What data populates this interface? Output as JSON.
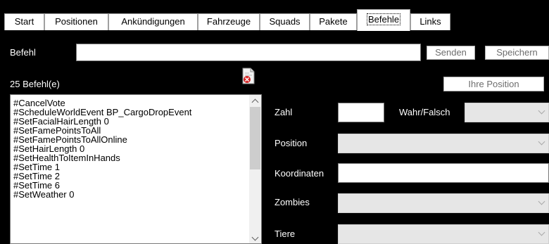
{
  "tabs": [
    {
      "label": "Start",
      "active": false
    },
    {
      "label": "Positionen",
      "active": false
    },
    {
      "label": "Ankündigungen",
      "active": false
    },
    {
      "label": "Fahrzeuge",
      "active": false
    },
    {
      "label": "Squads",
      "active": false
    },
    {
      "label": "Pakete",
      "active": false
    },
    {
      "label": "Befehle",
      "active": true
    },
    {
      "label": "Links",
      "active": false
    }
  ],
  "command_bar": {
    "label": "Befehl",
    "input_value": "",
    "send_label": "Senden",
    "save_label": "Speichern"
  },
  "commands": {
    "count_label": "25  Befehl(e)",
    "items": [
      "#CancelVote",
      "#ScheduleWorldEvent BP_CargoDropEvent",
      "#SetFacialHairLength 0",
      "#SetFamePointsToAll",
      "#SetFamePointsToAllOnline",
      "#SetHairLength 0",
      "#SetHealthToItemInHands",
      "#SetTime 1",
      "#SetTime 2",
      "#SetTime 6",
      "#SetWeather 0"
    ]
  },
  "position_button_label": "Ihre Position",
  "params": {
    "zahl_label": "Zahl",
    "zahl_value": "",
    "wahr_label": "Wahr/Falsch",
    "position_label": "Position",
    "koordinaten_label": "Koordinaten",
    "koordinaten_value": "",
    "zombies_label": "Zombies",
    "tiere_label": "Tiere"
  },
  "icons": {
    "delete": "delete-document-icon",
    "scroll_up": "scroll-up-arrow-icon",
    "scroll_down": "scroll-down-arrow-icon",
    "dropdown": "chevron-down-icon"
  },
  "colors": {
    "background": "#000000",
    "combo_disabled": "#e6e6e6",
    "button_text_disabled": "#6d6d6d",
    "delete_red": "#d42020"
  }
}
